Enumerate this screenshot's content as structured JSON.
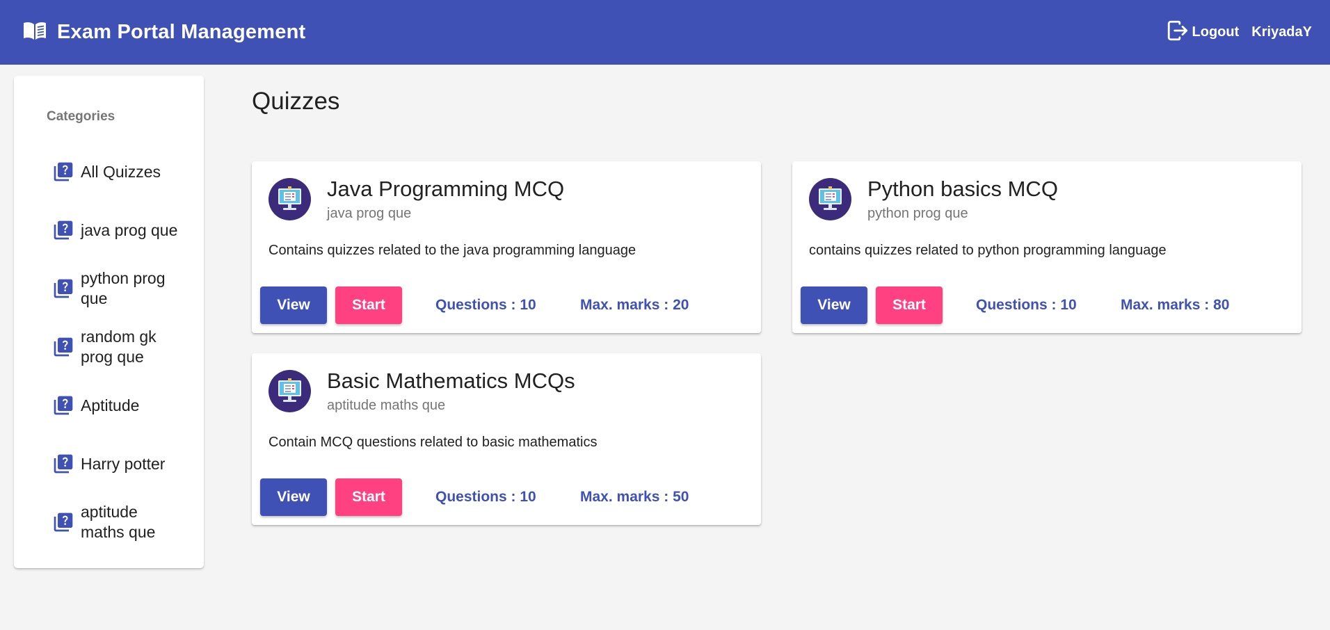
{
  "header": {
    "title": "Exam Portal Management",
    "logout_label": "Logout",
    "username": "KriyadaY",
    "bg_color": "#3f51b5",
    "icons": {
      "brand": "book-open-icon",
      "logout": "logout-icon"
    }
  },
  "sidebar": {
    "heading": "Categories",
    "item_icon": "quiz-help-icon",
    "items": [
      {
        "label": "All Quizzes"
      },
      {
        "label": "java prog que"
      },
      {
        "label": "python prog que"
      },
      {
        "label": "random gk prog que"
      },
      {
        "label": "Aptitude"
      },
      {
        "label": "Harry potter"
      },
      {
        "label": "aptitude maths que"
      }
    ]
  },
  "main": {
    "title": "Quizzes",
    "quizzes": [
      {
        "title": "Java Programming MCQ",
        "category": "java prog que",
        "description": "Contains quizzes related to the java programming language",
        "view_label": "View",
        "start_label": "Start",
        "questions_text": "Questions : 10",
        "max_marks_text": "Max. marks : 20"
      },
      {
        "title": "Python basics MCQ",
        "category": "python prog que",
        "description": "contains quizzes related to python programming language",
        "view_label": "View",
        "start_label": "Start",
        "questions_text": "Questions : 10",
        "max_marks_text": "Max. marks : 80"
      },
      {
        "title": "Basic Mathematics MCQs",
        "category": "aptitude maths que",
        "description": "Contain MCQ questions related to basic mathematics",
        "view_label": "View",
        "start_label": "Start",
        "questions_text": "Questions : 10",
        "max_marks_text": "Max. marks : 50"
      }
    ]
  },
  "colors": {
    "primary": "#3f51b5",
    "accent": "#ff4081",
    "background": "#f4f4f4"
  }
}
